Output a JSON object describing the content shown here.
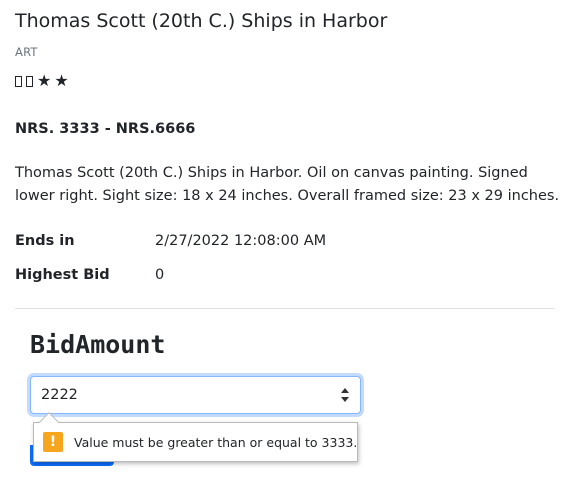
{
  "item": {
    "title": "Thomas Scott (20th C.) Ships in Harbor",
    "category": "ART",
    "rating": {
      "value": 2,
      "max": 4
    },
    "price_range": "NRS. 3333 - NRS.6666",
    "description": "Thomas Scott (20th C.) Ships in Harbor. Oil on canvas painting. Signed lower right. Sight size: 18 x 24 inches. Overall framed size: 23 x 29 inches."
  },
  "details": {
    "ends_in_label": "Ends in",
    "ends_in_value": "2/27/2022 12:08:00 AM",
    "highest_bid_label": "Highest Bid",
    "highest_bid_value": "0"
  },
  "bid_form": {
    "label": "BidAmount",
    "value": "2222",
    "validation_message": "Value must be greater than or equal to 3333.",
    "warning_icon_glyph": "!"
  },
  "colors": {
    "accent": "#0d6efd",
    "warning": "#f7a51c"
  },
  "icons": {
    "rating_empty": "empty-star-icon",
    "rating_full": "star-icon",
    "warning": "warning-icon",
    "spinner": "spinner-arrows-icon"
  }
}
